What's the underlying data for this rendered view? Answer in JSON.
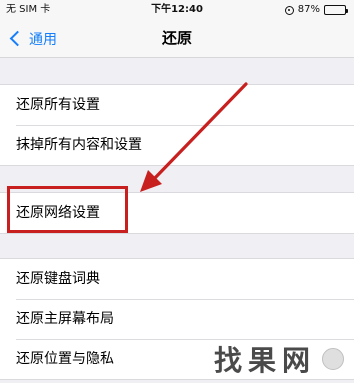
{
  "status_bar": {
    "carrier": "无 SIM 卡",
    "time": "下午12:40",
    "battery_percent_text": "87%",
    "battery_level": 0.87
  },
  "nav": {
    "back_label": "通用",
    "title": "还原"
  },
  "groups": [
    {
      "items": [
        "还原所有设置",
        "抹掉所有内容和设置"
      ]
    },
    {
      "items": [
        "还原网络设置"
      ]
    },
    {
      "items": [
        "还原键盘词典",
        "还原主屏幕布局",
        "还原位置与隐私"
      ]
    }
  ],
  "annotation": {
    "color": "#c81f1f",
    "highlighted_item": "还原网络设置"
  },
  "watermark": {
    "text": "找果网"
  },
  "colors": {
    "accent": "#147efb",
    "background": "#efeff4",
    "cell": "#ffffff"
  }
}
